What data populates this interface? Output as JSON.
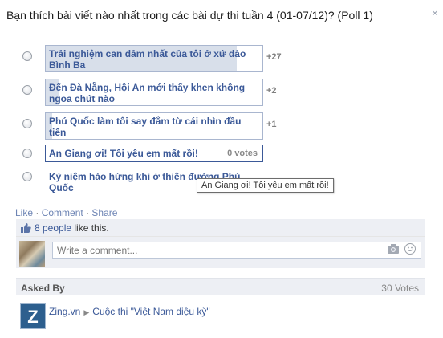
{
  "dialog": {
    "title": "Bạn thích bài viết nào nhất trong các bài dự thi tuần 4 (01-07/12)? (Poll 1)",
    "close_icon": "×"
  },
  "poll": {
    "options": [
      {
        "text": "Trải nghiệm can đảm nhất của tôi ở xứ đảo Bình Ba",
        "count": "+27",
        "fill_percent": 88
      },
      {
        "text": "Đến Đà Nẵng, Hội An mới thấy khen không ngoa chút nào",
        "count": "+2",
        "fill_percent": 6
      },
      {
        "text": "Phú Quốc làm tôi say đắm từ cái nhìn đầu tiên",
        "count": "+1",
        "fill_percent": 3
      },
      {
        "text": "An Giang ơi! Tôi yêu em mất rồi!",
        "count": "0 votes",
        "fill_percent": 0
      },
      {
        "text": "Kỷ niệm hào hứng khi ở thiên đường Phú Quốc",
        "count": "",
        "fill_percent": 0
      }
    ],
    "tooltip": "An Giang ơi! Tôi yêu em mất rồi!"
  },
  "actions": {
    "like": "Like",
    "comment": "Comment",
    "share": "Share",
    "separator": "·"
  },
  "likes": {
    "link": "8 people",
    "suffix": " like this."
  },
  "comment": {
    "placeholder": "Write a comment..."
  },
  "asked": {
    "label": "Asked By",
    "votes": "30 Votes"
  },
  "owner": {
    "name": "Zing.vn",
    "arrow": "▶",
    "target": "Cuộc thi \"Việt Nam diệu kỳ\"",
    "avatar_letter": "Z"
  },
  "colors": {
    "link": "#3b5998",
    "fill": "#d8dfea",
    "panel": "#edeff4"
  }
}
